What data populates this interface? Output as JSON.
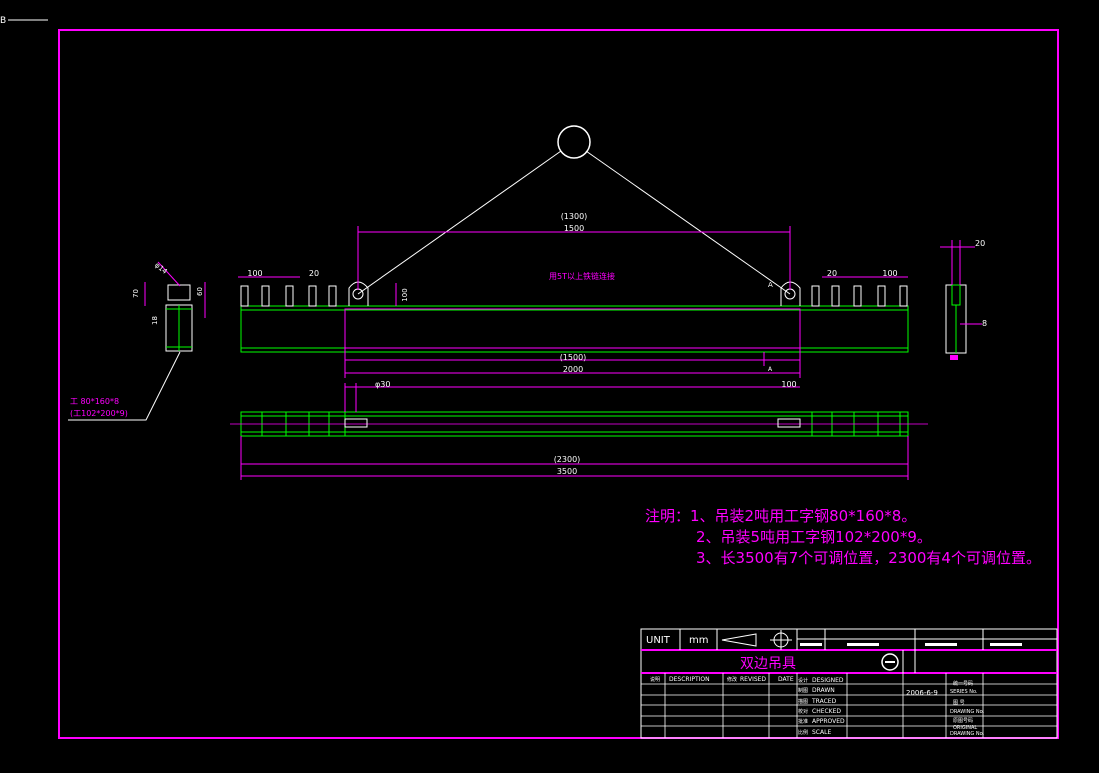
{
  "corner_mark": "B",
  "drawing": {
    "chain_note": "用5T以上铁链连接",
    "dims": {
      "span_upper_paren": "(1300)",
      "span_upper": "1500",
      "span_lower_paren": "(1500)",
      "span_lower": "2000",
      "left_pitch": "100",
      "left_gap": "20",
      "right_gap": "20",
      "right_pitch": "100",
      "ear_height": "100",
      "ear_label": "A",
      "hole_dia": "φ30",
      "plate_width": "100",
      "total_paren": "(2300)",
      "total": "3500",
      "section_dia": "φ14",
      "section_h1": "70",
      "section_h2": "60",
      "section_h3": "18",
      "right_top": "20",
      "right_side": "8",
      "lower_A": "A"
    },
    "section_label_1": "工 80*160*8",
    "section_label_2": "(工102*200*9)"
  },
  "notes": {
    "line1": "注明：1、吊装2吨用工字钢80*160*8。",
    "line2": "2、吊装5吨用工字钢102*200*9。",
    "line3": "3、长3500有7个可调位置，2300有4个可调位置。"
  },
  "title_block": {
    "unit_label": "UNIT",
    "unit_value": "mm",
    "drawing_title": "双边吊具",
    "col_description_cn": "说明",
    "col_description": "DESCRIPTION",
    "col_revised_cn": "修改",
    "col_revised": "REVISED",
    "col_date": "DATE",
    "designed_cn": "设计",
    "designed": "DESIGNED",
    "drawn_cn": "制图",
    "drawn": "DRAWN",
    "traced_cn": "描图",
    "traced": "TRACED",
    "checked_cn": "校对",
    "checked": "CHECKED",
    "approved_cn": "批准",
    "approved": "APPROVED",
    "scale_cn": "比例",
    "scale": "SCALE",
    "date_value": "2006-6-9",
    "series_cn": "统一号码",
    "series": "SERIES No.",
    "drawing_no_cn": "图    号",
    "drawing_no": "DRAWING No.",
    "original_cn": "原图号码",
    "original_1": "ORIGINAL",
    "original_2": "DRAWING No."
  }
}
